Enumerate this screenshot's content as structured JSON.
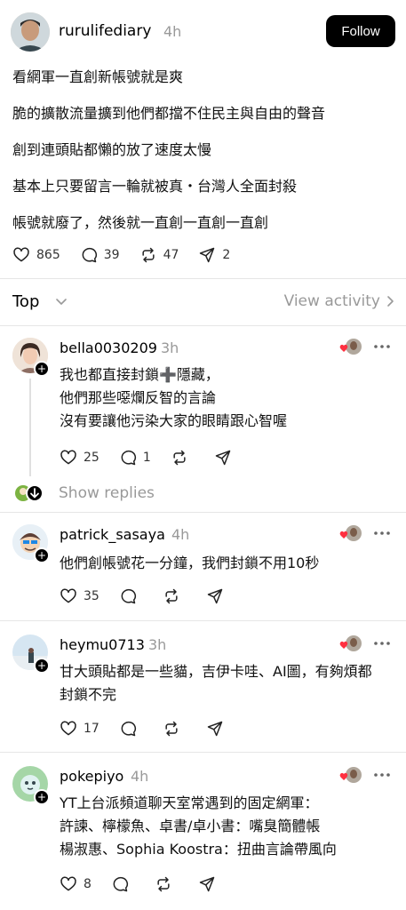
{
  "post": {
    "username": "rurulifediary",
    "time": "4h",
    "follow_label": "Follow",
    "lines": [
      "看網軍一直創新帳號就是爽",
      "脆的擴散流量擴到他們都擋不住民主與自由的聲音",
      "創到連頭貼都懶的放了速度太慢",
      "基本上只要留言一輪就被真・台灣人全面封殺",
      "帳號就廢了，然後就一直創一直創一直創"
    ],
    "likes": "865",
    "comments": "39",
    "reposts": "47",
    "shares": "2"
  },
  "sort": {
    "label": "Top",
    "view_activity": "View activity"
  },
  "replies": [
    {
      "username": "bella0030209",
      "time": "3h",
      "lines": [
        "我也都直接封鎖➕隱藏，",
        "他們那些噁爛反智的言論",
        "沒有要讓他污染大家的眼睛跟心智喔"
      ],
      "likes": "25",
      "comments": "1"
    },
    {
      "username": "patrick_sasaya",
      "time": "4h",
      "lines": [
        "他們創帳號花一分鐘，我們封鎖不用10秒"
      ],
      "likes": "35",
      "comments": ""
    },
    {
      "username": "heymu0713",
      "time": "3h",
      "lines": [
        "甘大頭貼都是一些貓，吉伊卡哇、AI圖，有夠煩都",
        "封鎖不完"
      ],
      "likes": "17",
      "comments": ""
    },
    {
      "username": "pokepiyo",
      "time": "4h",
      "lines": [
        "YT上台派頻道聊天室常遇到的固定網軍：",
        "許諫、檸檬魚、卓書/卓小書：嘴臭簡體帳",
        "楊淑惠、Sophia Koostra：扭曲言論帶風向"
      ],
      "likes": "8",
      "comments": ""
    }
  ],
  "show_replies": "Show replies",
  "colors": {
    "text": "#000000",
    "muted": "#999999",
    "divider": "#e6e6e6",
    "like_heart": "#ff3040"
  },
  "icons": [
    "heart-icon",
    "comment-icon",
    "repost-icon",
    "share-icon",
    "chevron-down-icon",
    "chevron-right-icon",
    "more-icon",
    "plus-icon"
  ]
}
